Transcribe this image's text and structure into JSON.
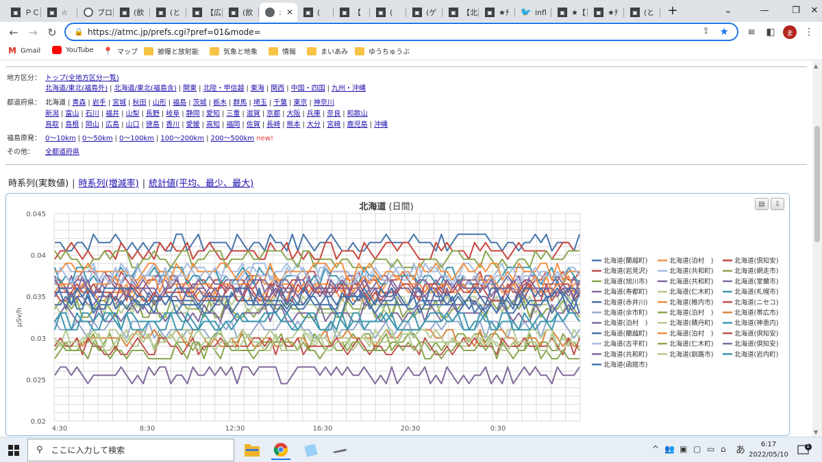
{
  "browser": {
    "tabs": [
      {
        "title": "ＰＣ",
        "icon": "site-icon",
        "active": false
      },
      {
        "title": "☆",
        "icon": "site-icon",
        "active": false
      },
      {
        "title": "ブロ",
        "icon": "circle-i-icon",
        "active": false
      },
      {
        "title": "(飲",
        "icon": "site-icon",
        "active": false
      },
      {
        "title": "(と",
        "icon": "site-icon",
        "active": false
      },
      {
        "title": "【広",
        "icon": "site-icon",
        "active": false
      },
      {
        "title": "(飲",
        "icon": "site-icon",
        "active": false
      },
      {
        "title": ":",
        "icon": "globe-icon",
        "active": true
      },
      {
        "title": "(",
        "icon": "site-icon",
        "active": false
      },
      {
        "title": "【",
        "icon": "site-icon",
        "active": false
      },
      {
        "title": "(",
        "icon": "site-icon",
        "active": false
      },
      {
        "title": "(ゲ",
        "icon": "site-icon",
        "active": false
      },
      {
        "title": "【北",
        "icon": "site-icon",
        "active": false
      },
      {
        "title": "★ﾁ",
        "icon": "site-icon",
        "active": false
      },
      {
        "title": "infl",
        "icon": "twitter-icon",
        "active": false
      },
      {
        "title": "★【",
        "icon": "site-icon",
        "active": false
      },
      {
        "title": "★ﾁ",
        "icon": "site-icon",
        "active": false
      },
      {
        "title": "(と",
        "icon": "site-icon",
        "active": false
      }
    ],
    "new_tab": "+",
    "url": "https://atmc.jp/prefs.cgi?pref=01&mode=",
    "avatar_letter": "ま",
    "bookmarks": [
      {
        "label": "Gmail",
        "icon": "gmail-icon"
      },
      {
        "label": "YouTube",
        "icon": "youtube-icon"
      },
      {
        "label": "マップ",
        "icon": "maps-icon"
      },
      {
        "label": "被曝と放射能",
        "icon": "folder-icon"
      },
      {
        "label": "気象と地象",
        "icon": "folder-icon"
      },
      {
        "label": "情報",
        "icon": "folder-icon"
      },
      {
        "label": "まいあみ",
        "icon": "folder-icon"
      },
      {
        "label": "ゆうちゅうぶ",
        "icon": "folder-icon"
      }
    ]
  },
  "nav": {
    "region_label": "地方区分：",
    "region_top": "トップ(全地方区分一覧)",
    "regions": [
      "北海道/東北(福島外)",
      "北海道/東北(福島含)",
      "関東",
      "北陸・甲信越",
      "東海",
      "関西",
      "中国・四国",
      "九州・沖縄"
    ],
    "pref_label": "都道府県：",
    "prefs_line1": [
      "北海道",
      "青森",
      "岩手",
      "宮城",
      "秋田",
      "山形",
      "福島",
      "茨城",
      "栃木",
      "群馬",
      "埼玉",
      "千葉",
      "東京",
      "神奈川"
    ],
    "prefs_line2": [
      "新潟",
      "富山",
      "石川",
      "福井",
      "山梨",
      "長野",
      "岐阜",
      "静岡",
      "愛知",
      "三重",
      "滋賀",
      "京都",
      "大阪",
      "兵庫",
      "奈良",
      "和歌山"
    ],
    "prefs_line3": [
      "鳥取",
      "島根",
      "岡山",
      "広島",
      "山口",
      "徳島",
      "香川",
      "愛媛",
      "高知",
      "福岡",
      "佐賀",
      "長崎",
      "熊本",
      "大分",
      "宮崎",
      "鹿児島",
      "沖縄"
    ],
    "fukushima_label": "福島原発：",
    "fukushima": [
      "0～10km",
      "0～50km",
      "0～100km",
      "100～200km",
      "200～500km"
    ],
    "new_badge": "new!",
    "other_label": "その他：",
    "other_link": "全都道府県"
  },
  "view_tabs": [
    "時系列(実数値)",
    "時系列(増減率)",
    "統計値(平均、最少、最大)"
  ],
  "chart_data": {
    "type": "line",
    "title": "北海道",
    "subtitle": "(日間)",
    "ylabel": "μSv/h",
    "ylim": [
      0.02,
      0.045
    ],
    "yticks": [
      "0.045",
      "0.04",
      "0.035",
      "0.03",
      "0.025",
      "0.02"
    ],
    "xtick_labels": [
      "4:30",
      "8:30",
      "12:30",
      "16:30",
      "20:30",
      "0:30"
    ],
    "grid": true,
    "legend_position": "right",
    "series": [
      {
        "name": "北海道(蘭越町)",
        "color": "#4572a7",
        "base": 0.0415
      },
      {
        "name": "北海道(泊村　)",
        "color": "#f28f43",
        "base": 0.0355
      },
      {
        "name": "北海道(倶知安)",
        "color": "#c8433c",
        "base": 0.0405
      },
      {
        "name": "北海道(岩見沢)",
        "color": "#c0504d",
        "base": 0.037
      },
      {
        "name": "北海道(共和町)",
        "color": "#a5bce0",
        "base": 0.038
      },
      {
        "name": "北海道(網走市)",
        "color": "#89a54e",
        "base": 0.0395
      },
      {
        "name": "北海道(旭川市)",
        "color": "#89a54e",
        "base": 0.0335
      },
      {
        "name": "北海道(共和町)",
        "color": "#80699b",
        "base": 0.036
      },
      {
        "name": "北海道(室蘭市)",
        "color": "#80699b",
        "base": 0.035
      },
      {
        "name": "北海道(寿都町)",
        "color": "#80699b",
        "base": 0.0365
      },
      {
        "name": "北海道(仁木町)",
        "color": "#b5ca92",
        "base": 0.034
      },
      {
        "name": "北海道(札幌市)",
        "color": "#3d96ae",
        "base": 0.0375
      },
      {
        "name": "北海道(赤井川)",
        "color": "#4572a7",
        "base": 0.0345
      },
      {
        "name": "北海道(稚内市)",
        "color": "#f28f43",
        "base": 0.0365
      },
      {
        "name": "北海道(ニセコ)",
        "color": "#c0504d",
        "base": 0.0355
      },
      {
        "name": "北海道(余市町)",
        "color": "#92a8cd",
        "base": 0.031
      },
      {
        "name": "北海道(泊村　)",
        "color": "#89a54e",
        "base": 0.0295
      },
      {
        "name": "北海道(帯広市)",
        "color": "#db843d",
        "base": 0.03
      },
      {
        "name": "北海道(泊村　)",
        "color": "#80699b",
        "base": 0.033
      },
      {
        "name": "北海道(積丹町)",
        "color": "#b5ca92",
        "base": 0.03
      },
      {
        "name": "北海道(神恵内)",
        "color": "#3d96ae",
        "base": 0.032
      },
      {
        "name": "北海道(蘭越町)",
        "color": "#4572a7",
        "base": 0.034
      },
      {
        "name": "北海道(泊村　)",
        "color": "#f28f43",
        "base": 0.038
      },
      {
        "name": "北海道(倶知安)",
        "color": "#c0504d",
        "base": 0.029
      },
      {
        "name": "北海道(古平町)",
        "color": "#a5bce0",
        "base": 0.0375
      },
      {
        "name": "北海道(仁木町)",
        "color": "#89a54e",
        "base": 0.0285
      },
      {
        "name": "北海道(倶知安)",
        "color": "#80699b",
        "base": 0.036
      },
      {
        "name": "北海道(共和町)",
        "color": "#80699b",
        "base": 0.0255
      },
      {
        "name": "北海道(釧路市)",
        "color": "#b5ca92",
        "base": 0.0295
      },
      {
        "name": "北海道(岩内町)",
        "color": "#3d96ae",
        "base": 0.032
      },
      {
        "name": "北海道(函館市)",
        "color": "#4572a7",
        "base": 0.035
      }
    ]
  },
  "taskbar": {
    "search_placeholder": "ここに入力して検索",
    "time": "6:17",
    "date": "2022/05/10",
    "ime": "あ",
    "notification_count": "1"
  }
}
